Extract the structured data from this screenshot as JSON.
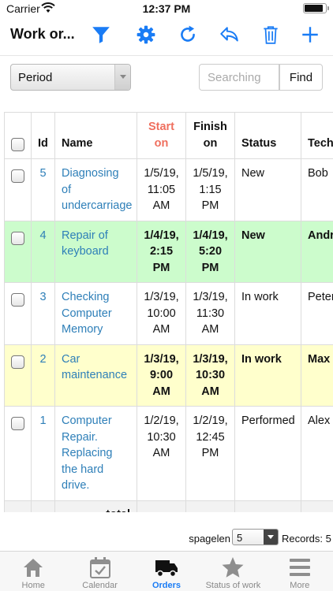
{
  "status_bar": {
    "carrier": "Carrier",
    "time": "12:37 PM",
    "battery_level": 0.9
  },
  "toolbar": {
    "title": "Work or..."
  },
  "icons": {
    "filter": "filter-icon",
    "settings": "gear-icon",
    "refresh": "refresh-icon",
    "undo": "undo-icon",
    "delete": "trash-icon",
    "add": "plus-icon"
  },
  "colors": {
    "accent": "#1a7cf5",
    "link": "#2e7fb8",
    "start_header": "#ef6f5e",
    "row_green": "#ccfccc",
    "row_yellow": "#ffffcc"
  },
  "filters": {
    "period_label": "Period",
    "search_placeholder": "Searching",
    "search_value": "",
    "find_label": "Find"
  },
  "table": {
    "columns": {
      "id": "Id",
      "name": "Name",
      "start_line1": "Start",
      "start_line2": "on",
      "finish_line1": "Finish",
      "finish_line2": "on",
      "status": "Status",
      "technician": "Tech"
    },
    "rows": [
      {
        "id": "5",
        "name": "Diagnosing of undercarriage",
        "start": "1/5/19, 11:05 AM",
        "finish": "1/5/19, 1:15 PM",
        "status": "New",
        "technician": "Bob",
        "color": "",
        "bold": false
      },
      {
        "id": "4",
        "name": "Repair of keyboard",
        "start": "1/4/19, 2:15 PM",
        "finish": "1/4/19, 5:20 PM",
        "status": "New",
        "technician": "Andr",
        "color": "#ccfccc",
        "bold": true
      },
      {
        "id": "3",
        "name": "Checking Computer Memory",
        "start": "1/3/19, 10:00 AM",
        "finish": "1/3/19, 11:30 AM",
        "status": "In work",
        "technician": "Peter",
        "color": "",
        "bold": false
      },
      {
        "id": "2",
        "name": "Car maintenance",
        "start": "1/3/19, 9:00 AM",
        "finish": "1/3/19, 10:30 AM",
        "status": "In work",
        "technician": "Max",
        "color": "#ffffcc",
        "bold": true
      },
      {
        "id": "1",
        "name": "Computer Repair. Replacing the hard drive.",
        "start": "1/2/19, 10:30 AM",
        "finish": "1/2/19, 12:45 PM",
        "status": "Performed",
        "technician": "Alex",
        "color": "",
        "bold": false
      }
    ],
    "total_label": "total"
  },
  "pager": {
    "page_length_label": "spagelen",
    "page_length": "5",
    "records_label": "Records: 5"
  },
  "tabs": [
    {
      "label": "Home",
      "icon": "home-icon",
      "active": false
    },
    {
      "label": "Calendar",
      "icon": "calendar-icon",
      "active": false
    },
    {
      "label": "Orders",
      "icon": "truck-icon",
      "active": true
    },
    {
      "label": "Status of work",
      "icon": "star-icon",
      "active": false
    },
    {
      "label": "More",
      "icon": "menu-icon",
      "active": false
    }
  ]
}
